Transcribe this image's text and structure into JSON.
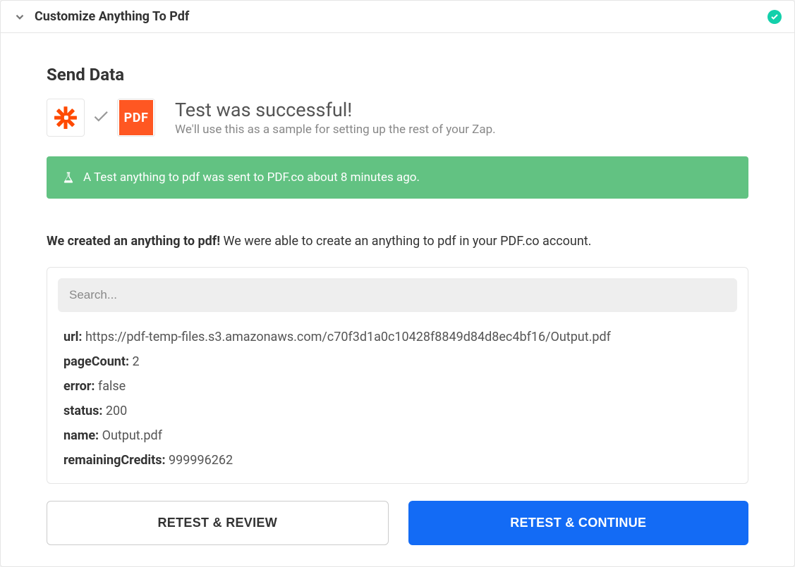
{
  "header": {
    "title": "Customize Anything To Pdf"
  },
  "section": {
    "title": "Send Data",
    "pdf_label": "PDF",
    "test_heading": "Test was successful!",
    "test_sub": "We'll use this as a sample for setting up the rest of your Zap."
  },
  "alert": {
    "text": "A Test anything to pdf was sent to PDF.co about 8 minutes ago."
  },
  "created": {
    "bold": "We created an anything to pdf!",
    "rest": " We were able to create an anything to pdf in your PDF.co account."
  },
  "search": {
    "placeholder": "Search..."
  },
  "results": {
    "url_label": "url:",
    "url_value": " https://pdf-temp-files.s3.amazonaws.com/c70f3d1a0c10428f8849d84d8ec4bf16/Output.pdf",
    "pageCount_label": "pageCount:",
    "pageCount_value": " 2",
    "error_label": "error:",
    "error_value": " false",
    "status_label": "status:",
    "status_value": " 200",
    "name_label": "name:",
    "name_value": " Output.pdf",
    "remainingCredits_label": "remainingCredits:",
    "remainingCredits_value": " 999996262"
  },
  "buttons": {
    "retest_review": "RETEST & REVIEW",
    "retest_continue": "RETEST & CONTINUE"
  }
}
